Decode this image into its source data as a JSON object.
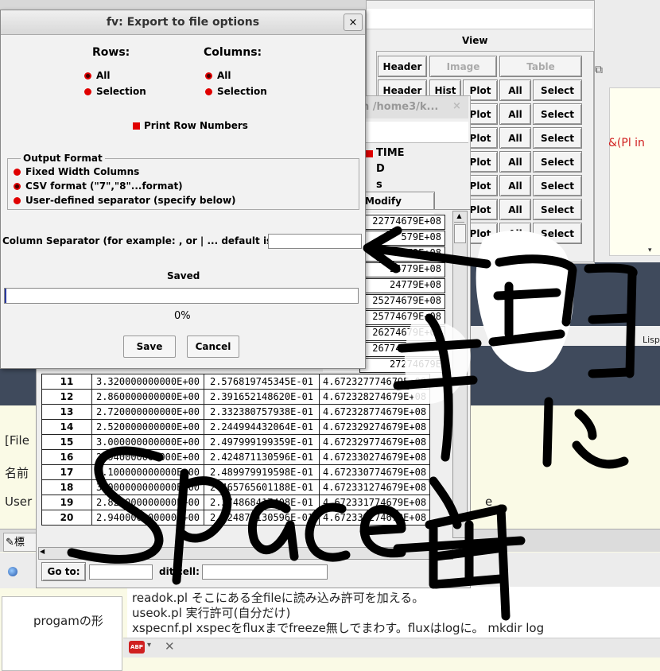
{
  "dialog": {
    "title": "fv: Export to file options",
    "close_label": "×",
    "rows_header": "Rows:",
    "columns_header": "Columns:",
    "rows_options": [
      "All",
      "Selection"
    ],
    "columns_options": [
      "All",
      "Selection"
    ],
    "print_row_numbers": "Print Row Numbers",
    "output_format_title": "Output Format",
    "output_formats": [
      "Fixed Width Columns",
      "CSV format (\"7\",\"8\"...format)",
      "User-defined separator (specify below)"
    ],
    "separator_label": "Column Separator (for example: , or | ... default is \" \" ):",
    "separator_value": "",
    "status_text": "Saved",
    "progress_text": "0%",
    "progress_value": 0.0,
    "save_button": "Save",
    "cancel_button": "Cancel"
  },
  "view_window": {
    "view_label": "View",
    "top_buttons": [
      "Header",
      "Image",
      "Table"
    ],
    "rows": [
      [
        "Header",
        "Hist",
        "Plot",
        "All",
        "Select"
      ],
      [
        "Plot",
        "All",
        "Select"
      ],
      [
        "Plot",
        "All",
        "Select"
      ],
      [
        "Plot",
        "All",
        "Select"
      ],
      [
        "Plot",
        "All",
        "Select"
      ],
      [
        "Plot",
        "All",
        "Select"
      ],
      [
        "Plot",
        "All",
        "Select"
      ]
    ]
  },
  "column_window": {
    "title": "n /home3/k...",
    "close_label": "×",
    "items": [
      "TIME",
      "D",
      "s"
    ],
    "modify_label": "Modify"
  },
  "table": {
    "partial_rows": [
      "22774679E+08",
      "579E+08",
      "579E+08",
      "24779E+08",
      "24779E+08",
      "25274679E+08",
      "25774679E+08",
      "26274679E+08",
      "26774679E+08",
      "27274679E"
    ],
    "rows": [
      [
        "11",
        "3.320000000000E+00",
        "2.576819745345E-01",
        "4.672327774679E+08"
      ],
      [
        "12",
        "2.860000000000E+00",
        "2.391652148620E-01",
        "4.672328274679E+08"
      ],
      [
        "13",
        "2.720000000000E+00",
        "2.332380757938E-01",
        "4.672328774679E+08"
      ],
      [
        "14",
        "2.520000000000E+00",
        "2.244994432064E-01",
        "4.672329274679E+08"
      ],
      [
        "15",
        "3.000000000000E+00",
        "2.497999199359E-01",
        "4.672329774679E+08"
      ],
      [
        "16",
        "2.940000000000E+00",
        "2.424871130596E-01",
        "4.672330274679E+08"
      ],
      [
        "17",
        "3.100000000000E+00",
        "2.489979919598E-01",
        "4.672330774679E+08"
      ],
      [
        "18",
        "3.000000000000E+00",
        "2.465765601188E-01",
        "4.672331274679E+08"
      ],
      [
        "19",
        "2.820000000000E+00",
        "2.374868417408E-01",
        "4.672331774679E+08"
      ],
      [
        "20",
        "2.940000000000E+00",
        "2.424871130596E-01",
        "4.672332274679E+08"
      ]
    ],
    "goto_label": "Go to:",
    "edit_cell_label": "dit cell:"
  },
  "background": {
    "red_text": "&(Pl in",
    "lisp_text": "Lisp",
    "file_text": "[File",
    "name_text": "名前",
    "user_text": "User",
    "e_text": "e",
    "tab_text": "標",
    "progam_label": "progamの形",
    "notes": [
      "readok.pl そこにある全fileに読み込み許可を加える。",
      "useok.pl 実行許可(自分だけ)",
      "xspecnf.pl  xspecをfluxまでfreeze無しでまわす。fluxはlogに。   mkdir log"
    ],
    "abp_label": "ABP"
  },
  "annotation": {
    "text_space": "Space",
    "colors": {
      "ink": "#000000",
      "accent": "#e00000"
    }
  }
}
